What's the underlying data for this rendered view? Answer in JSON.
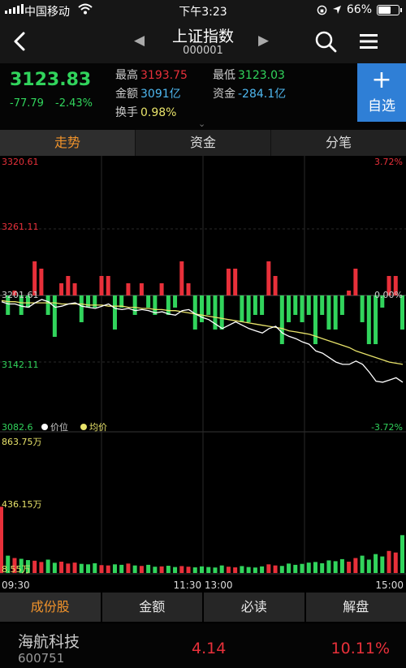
{
  "status_bar": {
    "carrier": "中国移动",
    "time": "下午3:23",
    "battery": "66%",
    "battery_level": 0.66
  },
  "nav": {
    "title": "上证指数",
    "code": "000001"
  },
  "quote": {
    "price": "3123.83",
    "change": "-77.79",
    "change_pct": "-2.43%",
    "high_label": "最高",
    "high": "3193.75",
    "low_label": "最低",
    "low": "3123.03",
    "amount_label": "金额",
    "amount": "3091亿",
    "fund_label": "资金",
    "fund": "-284.1亿",
    "turnover_label": "换手",
    "turnover": "0.98%",
    "favorite_label": "自选"
  },
  "tabs": [
    "走势",
    "资金",
    "分笔"
  ],
  "bottom_tabs": [
    "成份股",
    "金额",
    "必读",
    "解盘"
  ],
  "stock_row": {
    "name": "海航科技",
    "code": "600751",
    "price": "4.14",
    "change_pct": "10.11%"
  },
  "colors": {
    "up": "#e8303a",
    "down": "#31d45c",
    "price_line": "#ffffff",
    "avg_line": "#e8e36a",
    "accent": "#f0932b",
    "fav_bg": "#2f7fd6"
  },
  "chart_data": {
    "type": "line",
    "price_axis": {
      "max": "3320.61",
      "upper": "3261.11",
      "prev_close": "3201.61",
      "lower": "3142.11",
      "min": "3082.6"
    },
    "pct_axis": {
      "max": "3.72%",
      "zero": "0.00%",
      "min": "-3.72%"
    },
    "volume_axis": {
      "max": "863.75万",
      "mid": "436.15万",
      "min": "8.55万"
    },
    "legend": [
      "价位",
      "均价"
    ],
    "time_labels": [
      "09:30",
      "11:30 13:00",
      "15:00"
    ],
    "price_series": [
      3196,
      3194,
      3194,
      3192,
      3191,
      3195,
      3198,
      3196,
      3191,
      3192,
      3194,
      3195,
      3192,
      3191,
      3190,
      3192,
      3194,
      3190,
      3189,
      3190,
      3188,
      3189,
      3188,
      3186,
      3187,
      3185,
      3184,
      3188,
      3189,
      3185,
      3182,
      3180,
      3176,
      3172,
      3175,
      3178,
      3175,
      3172,
      3170,
      3168,
      3172,
      3174,
      3168,
      3165,
      3163,
      3160,
      3158,
      3152,
      3150,
      3146,
      3142,
      3140,
      3140,
      3143,
      3140,
      3133,
      3125,
      3124,
      3126,
      3128,
      3124
    ],
    "avg_series": [
      3197,
      3196,
      3196,
      3195,
      3195,
      3195,
      3195,
      3195,
      3195,
      3194,
      3194,
      3194,
      3194,
      3193,
      3193,
      3193,
      3192,
      3192,
      3192,
      3191,
      3191,
      3190,
      3190,
      3189,
      3189,
      3188,
      3188,
      3187,
      3186,
      3185,
      3184,
      3183,
      3182,
      3181,
      3180,
      3179,
      3178,
      3177,
      3176,
      3175,
      3174,
      3173,
      3172,
      3170,
      3169,
      3168,
      3167,
      3165,
      3163,
      3161,
      3159,
      3157,
      3155,
      3152,
      3150,
      3148,
      3146,
      3144,
      3142,
      3141,
      3140
    ],
    "volume_series": [
      420,
      110,
      95,
      90,
      82,
      78,
      70,
      85,
      65,
      72,
      60,
      66,
      58,
      55,
      62,
      50,
      48,
      55,
      52,
      60,
      48,
      45,
      52,
      40,
      42,
      46,
      38,
      44,
      40,
      36,
      42,
      38,
      35,
      48,
      40,
      36,
      44,
      38,
      35,
      42,
      55,
      48,
      45,
      60,
      52,
      58,
      66,
      70,
      62,
      80,
      75,
      88,
      72,
      95,
      110,
      85,
      120,
      105,
      140,
      130,
      240
    ]
  }
}
